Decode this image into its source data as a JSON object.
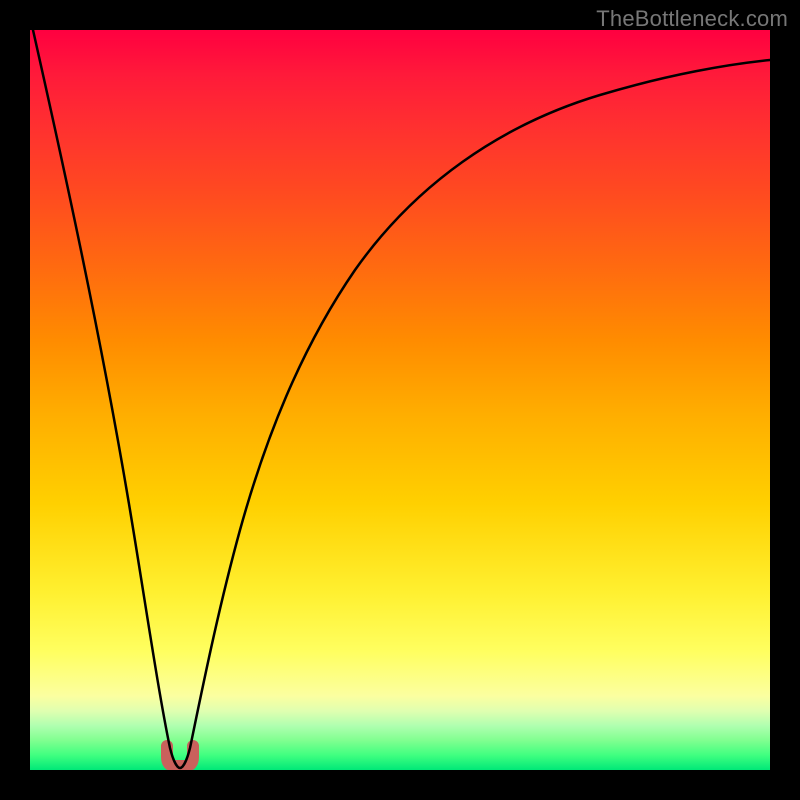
{
  "watermark": "TheBottleneck.com",
  "chart_data": {
    "type": "line",
    "title": "",
    "xlabel": "",
    "ylabel": "",
    "xlim": [
      0,
      100
    ],
    "ylim": [
      0,
      100
    ],
    "series": [
      {
        "name": "bottleneck-curve",
        "x": [
          0,
          4,
          8,
          12,
          15,
          17,
          18,
          19,
          20,
          21,
          22,
          24,
          27,
          31,
          36,
          42,
          50,
          60,
          70,
          80,
          90,
          100
        ],
        "values": [
          100,
          85,
          67,
          47,
          28,
          14,
          6,
          2,
          1,
          2,
          6,
          16,
          30,
          44,
          56,
          66,
          75,
          82,
          86.5,
          89.5,
          91.5,
          93
        ]
      }
    ],
    "marker": {
      "name": "valley-marker",
      "x_range": [
        18.5,
        21.5
      ],
      "y": 2,
      "color": "#c9615c"
    },
    "background_gradient": {
      "top": "#ff0040",
      "bottom": "#00e878"
    }
  }
}
